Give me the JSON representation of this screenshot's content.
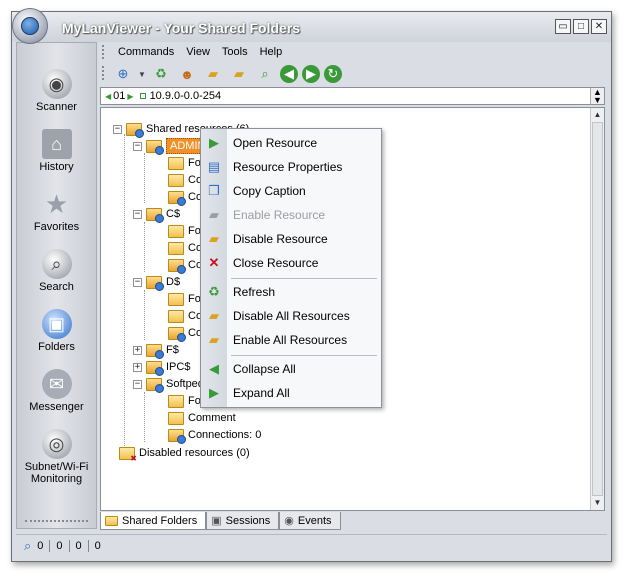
{
  "window": {
    "title": "MyLanViewer - Your Shared Folders"
  },
  "window_buttons": [
    "minimize",
    "maximize",
    "close"
  ],
  "sidebar": {
    "items": [
      {
        "label": "Scanner",
        "icon": "scanner-icon"
      },
      {
        "label": "History",
        "icon": "history-icon"
      },
      {
        "label": "Favorites",
        "icon": "star-icon"
      },
      {
        "label": "Search",
        "icon": "search-icon"
      },
      {
        "label": "Folders",
        "icon": "folders-icon"
      },
      {
        "label": "Messenger",
        "icon": "messenger-icon"
      },
      {
        "label": "Subnet/Wi-Fi Monitoring",
        "icon": "monitoring-icon"
      }
    ]
  },
  "menubar": {
    "items": [
      "Commands",
      "View",
      "Tools",
      "Help"
    ]
  },
  "toolbar": {
    "buttons": [
      "scan-network-icon",
      "refresh-icon",
      "users-icon",
      "open-folder-icon",
      "shared-folder-icon",
      "search-icon",
      "back-icon",
      "forward-icon",
      "reload-icon"
    ]
  },
  "range": {
    "value": "10.9.0-0.0-254",
    "prefix": "01"
  },
  "tree": {
    "root": "Shared resources (6)",
    "nodes": [
      {
        "label": "ADMIN$",
        "selected": true
      },
      {
        "label": "Folde"
      },
      {
        "label": "Com"
      },
      {
        "label": "Conn"
      },
      {
        "label": "C$"
      },
      {
        "label": "Folde"
      },
      {
        "label": "Com"
      },
      {
        "label": "Conn"
      },
      {
        "label": "D$"
      },
      {
        "label": "Folde"
      },
      {
        "label": "Com"
      },
      {
        "label": "Conn"
      },
      {
        "label": "F$"
      },
      {
        "label": "IPC$"
      },
      {
        "label": "Softpedi"
      },
      {
        "label": "Folde"
      },
      {
        "label": "Comment"
      },
      {
        "label": "Connections: 0"
      }
    ],
    "disabled": "Disabled resources (0)"
  },
  "context_menu": {
    "items": [
      {
        "label": "Open Resource",
        "icon": "open-resource-icon",
        "enabled": true
      },
      {
        "label": "Resource Properties",
        "icon": "properties-icon",
        "enabled": true
      },
      {
        "label": "Copy Caption",
        "icon": "copy-icon",
        "enabled": true
      },
      {
        "label": "Enable Resource",
        "icon": "enable-resource-icon",
        "enabled": false
      },
      {
        "label": "Disable Resource",
        "icon": "disable-resource-icon",
        "enabled": true
      },
      {
        "label": "Close Resource",
        "icon": "close-icon",
        "enabled": true
      },
      {
        "label": "Refresh",
        "icon": "refresh-icon",
        "enabled": true
      },
      {
        "label": "Disable All  Resources",
        "icon": "disable-all-icon",
        "enabled": true
      },
      {
        "label": "Enable All Resources",
        "icon": "enable-all-icon",
        "enabled": true
      },
      {
        "label": "Collapse All",
        "icon": "collapse-icon",
        "enabled": true
      },
      {
        "label": "Expand All",
        "icon": "expand-icon",
        "enabled": true
      }
    ]
  },
  "tabs": [
    {
      "label": "Shared Folders",
      "icon": "shared-folder-icon",
      "active": true
    },
    {
      "label": "Sessions",
      "icon": "sessions-icon",
      "active": false
    },
    {
      "label": "Events",
      "icon": "events-icon",
      "active": false
    }
  ],
  "status": {
    "values": [
      "0",
      "0",
      "0",
      "0"
    ]
  },
  "colors": {
    "selection": "#f0902a",
    "accent_green": "#3a9a3a",
    "close_red": "#c0141c"
  }
}
